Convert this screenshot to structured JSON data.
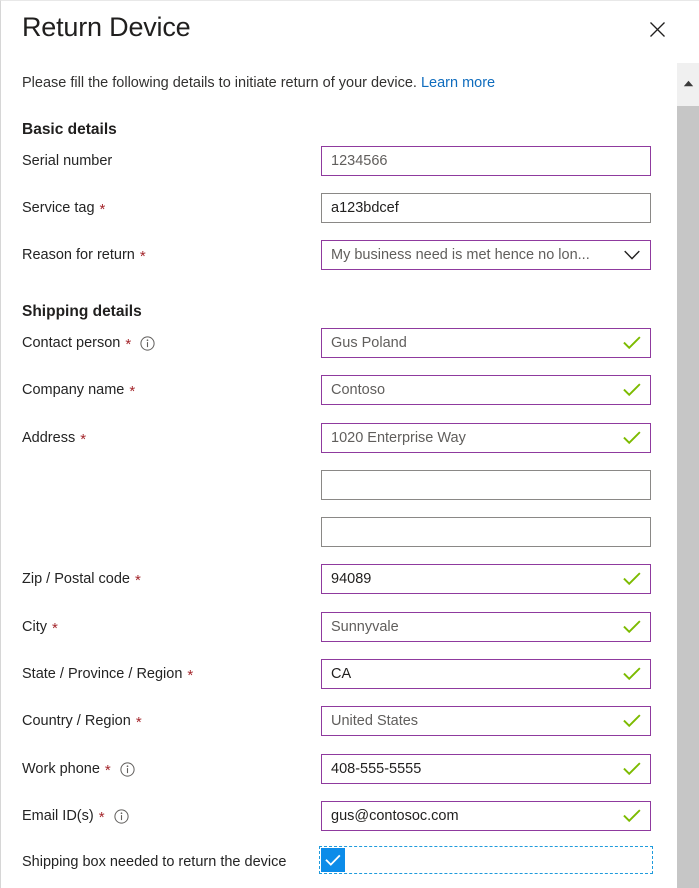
{
  "dialog": {
    "title": "Return Device",
    "close_label": "Close",
    "intro_text": "Please fill the following details to initiate return of your device.",
    "learn_more_label": "Learn more"
  },
  "sections": {
    "basic": {
      "heading": "Basic details",
      "fields": [
        {
          "label": "Serial number",
          "required": false,
          "info": false,
          "value": "1234566",
          "type": "text",
          "border": "accent",
          "muted": true,
          "valid": false
        },
        {
          "label": "Service tag",
          "required": true,
          "info": false,
          "value": "a123bdcef",
          "type": "text",
          "border": "default",
          "muted": false,
          "valid": false
        },
        {
          "label": "Reason for return",
          "required": true,
          "info": false,
          "value": "My business need is met hence no lon...",
          "type": "select",
          "border": "accent",
          "muted": true,
          "valid": false
        }
      ]
    },
    "shipping": {
      "heading": "Shipping details",
      "fields": [
        {
          "label": "Contact person",
          "required": true,
          "info": true,
          "value": "Gus Poland",
          "type": "text",
          "border": "accent",
          "muted": true,
          "valid": true
        },
        {
          "label": "Company name",
          "required": true,
          "info": false,
          "value": "Contoso",
          "type": "text",
          "border": "accent",
          "muted": true,
          "valid": true
        },
        {
          "label": "Address",
          "required": true,
          "info": false,
          "value": "1020 Enterprise Way",
          "type": "text",
          "border": "accent",
          "muted": true,
          "valid": true
        },
        {
          "label": "",
          "required": false,
          "info": false,
          "value": "",
          "type": "text",
          "border": "default",
          "muted": false,
          "valid": false
        },
        {
          "label": "",
          "required": false,
          "info": false,
          "value": "",
          "type": "text",
          "border": "default",
          "muted": false,
          "valid": false
        },
        {
          "label": "Zip / Postal code",
          "required": true,
          "info": false,
          "value": "94089",
          "type": "text",
          "border": "accent",
          "muted": false,
          "valid": true
        },
        {
          "label": "City",
          "required": true,
          "info": false,
          "value": "Sunnyvale",
          "type": "text",
          "border": "accent",
          "muted": true,
          "valid": true
        },
        {
          "label": "State / Province / Region",
          "required": true,
          "info": false,
          "value": "CA",
          "type": "text",
          "border": "accent",
          "muted": false,
          "valid": true
        },
        {
          "label": "Country / Region",
          "required": true,
          "info": false,
          "value": "United States",
          "type": "text",
          "border": "accent",
          "muted": true,
          "valid": true
        },
        {
          "label": "Work phone",
          "required": true,
          "info": true,
          "value": "408-555-5555",
          "type": "text",
          "border": "accent",
          "muted": false,
          "valid": true
        },
        {
          "label": "Email ID(s)",
          "required": true,
          "info": true,
          "value": "gus@contosoc.com",
          "type": "text",
          "border": "accent",
          "muted": false,
          "valid": true
        }
      ],
      "checkbox": {
        "label": "Shipping box needed to return the device",
        "checked": true
      }
    }
  },
  "scrollbar": {
    "up_arrow_label": "Scroll up"
  },
  "colors": {
    "accent_border": "#8f3a9e",
    "default_border": "#8a8886",
    "required_asterisk": "#a4262c",
    "valid_check": "#7cbb00",
    "link": "#0f6cbd",
    "checkbox_fill": "#0c8ce9",
    "focus_dash": "#1f9bdc"
  }
}
